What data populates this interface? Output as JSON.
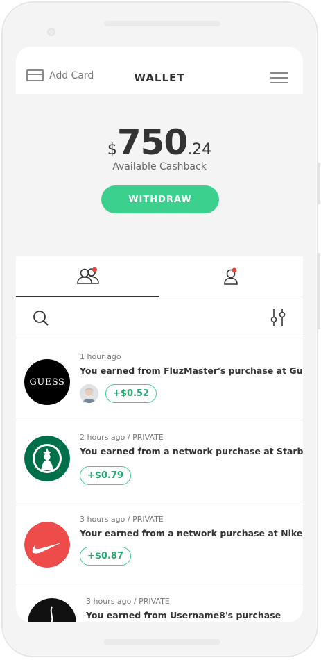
{
  "header": {
    "add_card_label": "Add Card",
    "title": "WALLET"
  },
  "balance": {
    "currency": "$",
    "whole": "750",
    "cents": ".24",
    "label": "Available Cashback",
    "withdraw_label": "WITHDRAW"
  },
  "tabs": [
    {
      "name": "network",
      "icon": "group-icon",
      "active": true,
      "has_notification": true
    },
    {
      "name": "personal",
      "icon": "person-icon",
      "active": false,
      "has_notification": true
    }
  ],
  "feed": [
    {
      "time": "1 hour ago",
      "message": "You earned from FluzMaster's purchase at Guess.",
      "amount": "+$0.52",
      "brand": "GUESS",
      "logo": "guess-logo",
      "has_avatar": true
    },
    {
      "time": "2 hours ago / PRIVATE",
      "message": "You earned from a network purchase at Starbucks",
      "amount": "+$0.79",
      "logo": "starbucks-logo",
      "has_avatar": false
    },
    {
      "time": "3 hours ago / PRIVATE",
      "message": "Your earned from a network purchase at Nike",
      "amount": "+$0.87",
      "logo": "nike-logo",
      "has_avatar": false
    },
    {
      "time": "3 hours ago / PRIVATE",
      "message": "You earned from Username8's purchase",
      "logo": "dark-logo",
      "has_avatar": false
    }
  ],
  "colors": {
    "accent": "#3cd08e",
    "notification": "#e4463b",
    "balance_bg": "#f4f4f4"
  }
}
